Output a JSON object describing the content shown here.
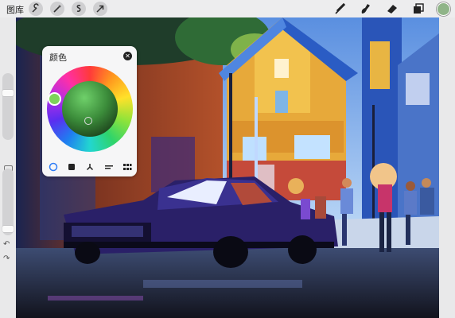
{
  "topbar": {
    "gallery_label": "图库",
    "tools_left": [
      "wrench-icon",
      "magic-wand-icon",
      "selection-icon",
      "transform-arrow-icon"
    ],
    "tools_right": [
      "brush-icon",
      "smudge-icon",
      "eraser-icon",
      "layers-icon"
    ],
    "current_color": "#8fb488"
  },
  "color_panel": {
    "title": "颜色",
    "modes": [
      "disc",
      "classic",
      "harmony",
      "value",
      "palettes"
    ],
    "selected_mode": "disc"
  },
  "sidebar": {
    "brush_size": 0.72,
    "opacity": 0.05,
    "undo_icon": "undo-icon",
    "redo_icon": "redo-icon"
  },
  "colors": {
    "toolbar_bg": "#ededee",
    "panel_bg": "#f6f6f7",
    "accent": "#2f7df6"
  }
}
